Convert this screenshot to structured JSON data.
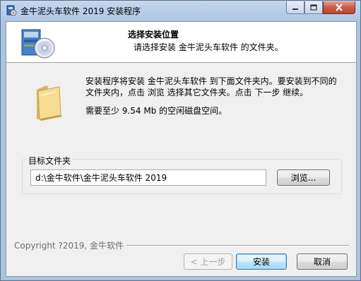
{
  "window": {
    "title": "金牛泥头车软件 2019 安装程序"
  },
  "header": {
    "title": "选择安装位置",
    "subtitle": "请选择安装 金牛泥头车软件 的文件夹。"
  },
  "body": {
    "description_line1": "安装程序将安装 金牛泥头车软件 到下面文件夹内。要安装到不同的",
    "description_line2": "文件夹内，点击 浏览 选择其它文件夹。点击 下一步 继续。",
    "space_required": "需要至少 9.54 Mb 的空闲磁盘空间。"
  },
  "destination": {
    "label": "目标文件夹",
    "path": "d:\\金牛软件\\金牛泥头车软件 2019",
    "browse_label": "浏览..."
  },
  "footer": {
    "copyright": "Copyright ?2019, 金牛软件",
    "back_label": "< 上一步",
    "install_label": "安装",
    "cancel_label": "取消"
  },
  "colors": {
    "titlebar": "#adc6e3",
    "close_button": "#c75c48",
    "dialog_bg": "#f0f0f0",
    "default_button_border": "#3c7fb1"
  }
}
